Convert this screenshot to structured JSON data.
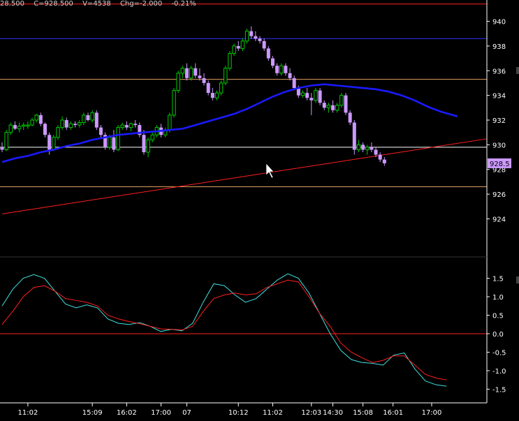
{
  "header": {
    "last": "28.500",
    "close": "C=928.500",
    "volume": "V=4538",
    "change": "Chg=-2.000",
    "change_pct": "-0.21%"
  },
  "colors": {
    "background": "#000000",
    "up_candle": "#00cc00",
    "down_candle": "#cc99ff",
    "moving_average": "#1a1aff",
    "trendline": "#ff2020",
    "resistance_line": "#ff2020",
    "blue_level": "#3333ff",
    "orange_level": "#e0a060",
    "white_level": "#ffffff",
    "osc_fast": "#40e0e0",
    "osc_slow": "#ff2020",
    "price_tag": "#cc99ff"
  },
  "chart_data": [
    {
      "type": "candlestick",
      "title": "",
      "ylim": [
        922.5,
        941.5
      ],
      "y_ticks": [
        924,
        926,
        928,
        930,
        932,
        934,
        936,
        938,
        940
      ],
      "x_ticks": [
        "11:02",
        "15:09",
        "16:02",
        "17:00",
        "07",
        "10:12",
        "11:02",
        "12:03",
        "14:30",
        "15:08",
        "16:01",
        "17:00"
      ],
      "x_tick_index": [
        6,
        21,
        29,
        37,
        43,
        55,
        63,
        72,
        77,
        84,
        91,
        100
      ],
      "bar_count": 107,
      "last_price_label": "928.5",
      "horizontal_lines": [
        {
          "value": 941.4,
          "color": "red"
        },
        {
          "value": 938.6,
          "color": "blue"
        },
        {
          "value": 935.3,
          "color": "orange"
        },
        {
          "value": 929.8,
          "color": "white"
        },
        {
          "value": 926.6,
          "color": "orange"
        }
      ],
      "trendline": {
        "from": [
          0,
          924.4
        ],
        "to": [
          115,
          930.6
        ]
      },
      "moving_average": [
        [
          0,
          928.6
        ],
        [
          3,
          928.9
        ],
        [
          6,
          929.1
        ],
        [
          9,
          929.4
        ],
        [
          12,
          929.6
        ],
        [
          15,
          929.9
        ],
        [
          18,
          930.1
        ],
        [
          21,
          930.4
        ],
        [
          24,
          930.6
        ],
        [
          27,
          930.8
        ],
        [
          30,
          930.9
        ],
        [
          33,
          931.0
        ],
        [
          36,
          931.1
        ],
        [
          39,
          931.2
        ],
        [
          42,
          931.3
        ],
        [
          45,
          931.6
        ],
        [
          48,
          931.9
        ],
        [
          51,
          932.2
        ],
        [
          54,
          932.5
        ],
        [
          57,
          932.9
        ],
        [
          60,
          933.4
        ],
        [
          63,
          933.9
        ],
        [
          66,
          934.3
        ],
        [
          69,
          934.6
        ],
        [
          72,
          934.8
        ],
        [
          75,
          934.9
        ],
        [
          78,
          934.8
        ],
        [
          81,
          934.7
        ],
        [
          84,
          934.6
        ],
        [
          87,
          934.5
        ],
        [
          90,
          934.3
        ],
        [
          93,
          934.0
        ],
        [
          96,
          933.6
        ],
        [
          99,
          933.1
        ],
        [
          102,
          932.7
        ],
        [
          106,
          932.3
        ]
      ],
      "candles": [
        [
          929.8,
          930.2,
          929.4,
          929.6
        ],
        [
          929.6,
          931.2,
          929.5,
          931.0
        ],
        [
          931.0,
          931.8,
          930.8,
          931.6
        ],
        [
          931.6,
          931.9,
          931.2,
          931.3
        ],
        [
          931.3,
          931.8,
          931.0,
          931.5
        ],
        [
          931.5,
          931.8,
          931.2,
          931.6
        ],
        [
          931.6,
          931.9,
          931.3,
          931.6
        ],
        [
          931.6,
          932.2,
          931.5,
          932.0
        ],
        [
          932.0,
          932.5,
          931.8,
          932.4
        ],
        [
          932.4,
          932.6,
          931.5,
          931.7
        ],
        [
          931.7,
          931.8,
          930.6,
          930.8
        ],
        [
          930.8,
          931.0,
          929.2,
          929.6
        ],
        [
          929.6,
          930.8,
          929.5,
          930.6
        ],
        [
          930.6,
          931.6,
          930.4,
          931.4
        ],
        [
          931.4,
          932.3,
          931.2,
          932.0
        ],
        [
          932.0,
          932.2,
          931.2,
          931.4
        ],
        [
          931.4,
          931.9,
          931.2,
          931.7
        ],
        [
          931.7,
          931.9,
          931.4,
          931.6
        ],
        [
          931.6,
          932.0,
          931.4,
          931.8
        ],
        [
          931.8,
          932.6,
          931.6,
          932.4
        ],
        [
          932.4,
          932.6,
          931.9,
          932.0
        ],
        [
          932.0,
          932.8,
          931.8,
          932.6
        ],
        [
          932.6,
          932.8,
          931.2,
          931.4
        ],
        [
          931.4,
          931.6,
          930.6,
          930.8
        ],
        [
          930.8,
          931.0,
          929.6,
          929.8
        ],
        [
          929.8,
          930.8,
          929.6,
          930.6
        ],
        [
          930.6,
          931.2,
          929.4,
          929.6
        ],
        [
          929.6,
          931.6,
          929.5,
          931.4
        ],
        [
          931.4,
          931.8,
          931.2,
          931.6
        ],
        [
          931.6,
          931.9,
          931.2,
          931.4
        ],
        [
          931.4,
          931.8,
          931.1,
          931.7
        ],
        [
          931.7,
          932.0,
          931.4,
          931.6
        ],
        [
          931.6,
          931.8,
          930.6,
          930.8
        ],
        [
          930.8,
          931.2,
          929.2,
          929.4
        ],
        [
          929.4,
          930.6,
          929.0,
          930.4
        ],
        [
          930.4,
          931.0,
          930.2,
          930.8
        ],
        [
          930.8,
          931.6,
          930.6,
          931.4
        ],
        [
          931.4,
          931.7,
          930.6,
          930.8
        ],
        [
          930.8,
          931.4,
          930.6,
          931.2
        ],
        [
          931.2,
          932.6,
          931.0,
          932.4
        ],
        [
          932.4,
          934.6,
          932.2,
          934.4
        ],
        [
          934.4,
          936.0,
          934.2,
          935.8
        ],
        [
          935.8,
          936.4,
          935.4,
          936.2
        ],
        [
          936.2,
          936.6,
          935.2,
          935.4
        ],
        [
          935.4,
          936.4,
          935.2,
          936.2
        ],
        [
          936.2,
          936.6,
          935.4,
          935.6
        ],
        [
          935.6,
          936.2,
          935.2,
          935.4
        ],
        [
          935.4,
          935.8,
          934.8,
          935.0
        ],
        [
          935.0,
          935.2,
          934.0,
          934.2
        ],
        [
          934.2,
          934.6,
          933.6,
          933.8
        ],
        [
          933.8,
          934.4,
          933.6,
          934.2
        ],
        [
          934.2,
          935.2,
          934.0,
          935.0
        ],
        [
          935.0,
          936.4,
          934.8,
          936.2
        ],
        [
          936.2,
          937.6,
          936.0,
          937.4
        ],
        [
          937.4,
          938.2,
          937.2,
          938.0
        ],
        [
          938.0,
          938.4,
          937.6,
          937.8
        ],
        [
          937.8,
          938.6,
          937.6,
          938.4
        ],
        [
          938.4,
          939.4,
          938.2,
          939.2
        ],
        [
          939.2,
          939.6,
          938.6,
          938.8
        ],
        [
          938.8,
          939.2,
          938.4,
          938.6
        ],
        [
          938.6,
          938.8,
          938.2,
          938.4
        ],
        [
          938.4,
          938.6,
          937.6,
          937.8
        ],
        [
          937.8,
          938.0,
          936.8,
          937.0
        ],
        [
          937.0,
          937.2,
          936.2,
          936.4
        ],
        [
          936.4,
          936.6,
          935.6,
          935.8
        ],
        [
          935.8,
          936.6,
          935.6,
          936.4
        ],
        [
          936.4,
          936.6,
          935.6,
          935.8
        ],
        [
          935.8,
          936.2,
          935.2,
          935.4
        ],
        [
          935.4,
          935.6,
          934.4,
          934.6
        ],
        [
          934.6,
          934.8,
          933.8,
          934.0
        ],
        [
          934.0,
          934.4,
          933.8,
          934.2
        ],
        [
          934.2,
          934.6,
          933.6,
          933.8
        ],
        [
          933.8,
          934.2,
          932.4,
          933.6
        ],
        [
          933.6,
          934.6,
          933.4,
          934.4
        ],
        [
          934.4,
          934.6,
          933.2,
          933.4
        ],
        [
          933.4,
          933.6,
          932.8,
          933.0
        ],
        [
          933.0,
          933.4,
          932.6,
          933.2
        ],
        [
          933.2,
          933.6,
          932.6,
          932.8
        ],
        [
          932.8,
          933.4,
          932.6,
          933.2
        ],
        [
          933.2,
          934.2,
          933.0,
          934.0
        ],
        [
          934.0,
          934.2,
          932.4,
          932.6
        ],
        [
          932.6,
          932.8,
          931.6,
          931.8
        ],
        [
          931.8,
          932.0,
          929.2,
          929.6
        ],
        [
          929.6,
          930.4,
          929.4,
          930.0
        ],
        [
          930.0,
          930.2,
          929.4,
          929.6
        ],
        [
          929.6,
          930.0,
          929.2,
          929.8
        ],
        [
          929.8,
          930.2,
          929.4,
          929.6
        ],
        [
          929.6,
          929.8,
          929.0,
          929.2
        ],
        [
          929.2,
          929.4,
          928.6,
          928.8
        ],
        [
          928.8,
          929.0,
          928.3,
          928.5
        ]
      ]
    },
    {
      "type": "line",
      "title": "",
      "ylim": [
        -1.7,
        1.85
      ],
      "y_ticks": [
        "1.5",
        "1.0",
        "0.5",
        "0.0",
        "-0.5",
        "-1.0",
        "-1.5"
      ],
      "zero_line": 0,
      "series": [
        {
          "name": "",
          "color": "cyan",
          "values": [
            [
              0,
              0.75
            ],
            [
              3,
              1.2
            ],
            [
              6,
              1.5
            ],
            [
              9,
              1.6
            ],
            [
              12,
              1.5
            ],
            [
              15,
              1.15
            ],
            [
              18,
              0.8
            ],
            [
              21,
              0.7
            ],
            [
              24,
              0.78
            ],
            [
              27,
              0.7
            ],
            [
              30,
              0.4
            ],
            [
              33,
              0.28
            ],
            [
              36,
              0.25
            ],
            [
              39,
              0.3
            ],
            [
              42,
              0.2
            ],
            [
              45,
              0.06
            ],
            [
              48,
              0.12
            ],
            [
              51,
              0.08
            ],
            [
              54,
              0.28
            ],
            [
              57,
              0.85
            ],
            [
              60,
              1.35
            ],
            [
              63,
              1.3
            ],
            [
              66,
              1.05
            ],
            [
              69,
              0.85
            ],
            [
              72,
              0.95
            ],
            [
              75,
              1.2
            ],
            [
              78,
              1.45
            ],
            [
              81,
              1.62
            ],
            [
              84,
              1.5
            ],
            [
              87,
              1.1
            ],
            [
              90,
              0.55
            ],
            [
              93,
              0.0
            ],
            [
              96,
              -0.45
            ],
            [
              99,
              -0.7
            ],
            [
              102,
              -0.78
            ],
            [
              105,
              -0.8
            ],
            [
              108,
              -0.85
            ],
            [
              111,
              -0.58
            ],
            [
              114,
              -0.52
            ],
            [
              117,
              -0.95
            ],
            [
              120,
              -1.28
            ],
            [
              123,
              -1.38
            ],
            [
              126,
              -1.42
            ]
          ]
        },
        {
          "name": "",
          "color": "red",
          "values": [
            [
              0,
              0.25
            ],
            [
              3,
              0.6
            ],
            [
              6,
              1.0
            ],
            [
              9,
              1.25
            ],
            [
              12,
              1.3
            ],
            [
              15,
              1.15
            ],
            [
              18,
              0.95
            ],
            [
              21,
              0.9
            ],
            [
              24,
              0.85
            ],
            [
              27,
              0.75
            ],
            [
              30,
              0.5
            ],
            [
              33,
              0.4
            ],
            [
              36,
              0.33
            ],
            [
              39,
              0.27
            ],
            [
              42,
              0.2
            ],
            [
              45,
              0.13
            ],
            [
              48,
              0.12
            ],
            [
              51,
              0.1
            ],
            [
              54,
              0.2
            ],
            [
              57,
              0.6
            ],
            [
              60,
              0.95
            ],
            [
              63,
              1.05
            ],
            [
              66,
              1.1
            ],
            [
              69,
              1.05
            ],
            [
              72,
              1.08
            ],
            [
              75,
              1.25
            ],
            [
              78,
              1.35
            ],
            [
              81,
              1.45
            ],
            [
              84,
              1.4
            ],
            [
              87,
              1.0
            ],
            [
              90,
              0.55
            ],
            [
              93,
              0.2
            ],
            [
              96,
              -0.25
            ],
            [
              99,
              -0.5
            ],
            [
              102,
              -0.65
            ],
            [
              105,
              -0.78
            ],
            [
              108,
              -0.72
            ],
            [
              111,
              -0.6
            ],
            [
              114,
              -0.6
            ],
            [
              117,
              -0.85
            ],
            [
              120,
              -1.1
            ],
            [
              123,
              -1.2
            ],
            [
              126,
              -1.25
            ]
          ]
        }
      ]
    }
  ]
}
